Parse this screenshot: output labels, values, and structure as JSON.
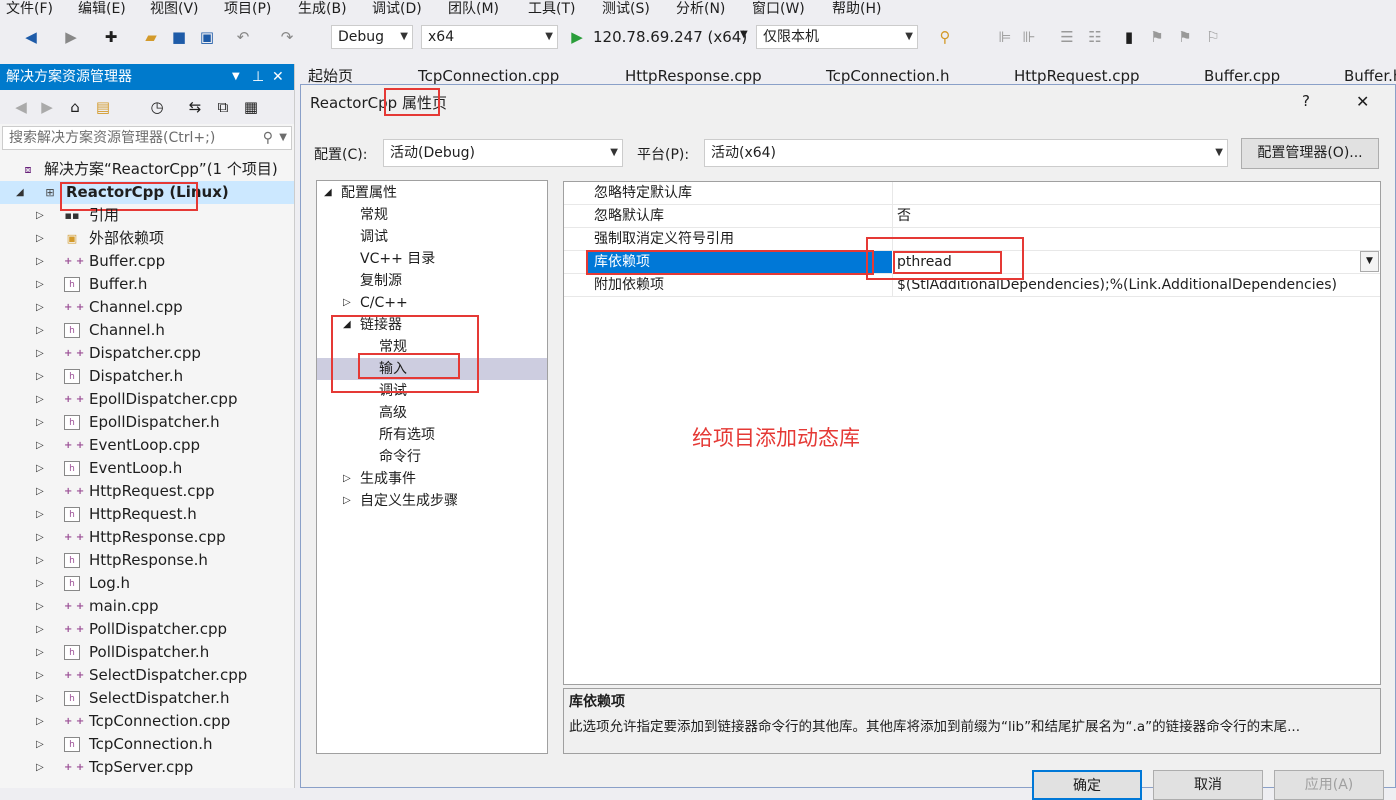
{
  "menu": [
    "文件(F)",
    "编辑(E)",
    "视图(V)",
    "项目(P)",
    "生成(B)",
    "调试(D)",
    "团队(M)",
    "工具(T)",
    "测试(S)",
    "分析(N)",
    "窗口(W)",
    "帮助(H)"
  ],
  "toolbar": {
    "config": "Debug",
    "platform": "x64",
    "run_target": "120.78.69.247 (x64)",
    "debug_scope": "仅限本机"
  },
  "solution_explorer": {
    "title": "解决方案资源管理器",
    "search_placeholder": "搜索解决方案资源管理器(Ctrl+;)",
    "solution": "解决方案“ReactorCpp”(1 个项目)",
    "project": "ReactorCpp (Linux)",
    "items": [
      {
        "label": "引用",
        "kind": "ref"
      },
      {
        "label": "外部依赖项",
        "kind": "ext"
      },
      {
        "label": "Buffer.cpp",
        "kind": "cpp"
      },
      {
        "label": "Buffer.h",
        "kind": "h"
      },
      {
        "label": "Channel.cpp",
        "kind": "cpp"
      },
      {
        "label": "Channel.h",
        "kind": "h"
      },
      {
        "label": "Dispatcher.cpp",
        "kind": "cpp"
      },
      {
        "label": "Dispatcher.h",
        "kind": "h"
      },
      {
        "label": "EpollDispatcher.cpp",
        "kind": "cpp"
      },
      {
        "label": "EpollDispatcher.h",
        "kind": "h"
      },
      {
        "label": "EventLoop.cpp",
        "kind": "cpp"
      },
      {
        "label": "EventLoop.h",
        "kind": "h"
      },
      {
        "label": "HttpRequest.cpp",
        "kind": "cpp"
      },
      {
        "label": "HttpRequest.h",
        "kind": "h"
      },
      {
        "label": "HttpResponse.cpp",
        "kind": "cpp"
      },
      {
        "label": "HttpResponse.h",
        "kind": "h"
      },
      {
        "label": "Log.h",
        "kind": "h"
      },
      {
        "label": "main.cpp",
        "kind": "cpp"
      },
      {
        "label": "PollDispatcher.cpp",
        "kind": "cpp"
      },
      {
        "label": "PollDispatcher.h",
        "kind": "h"
      },
      {
        "label": "SelectDispatcher.cpp",
        "kind": "cpp"
      },
      {
        "label": "SelectDispatcher.h",
        "kind": "h"
      },
      {
        "label": "TcpConnection.cpp",
        "kind": "cpp"
      },
      {
        "label": "TcpConnection.h",
        "kind": "h"
      },
      {
        "label": "TcpServer.cpp",
        "kind": "cpp"
      }
    ]
  },
  "tabs": [
    "起始页",
    "TcpConnection.cpp",
    "HttpResponse.cpp",
    "TcpConnection.h",
    "HttpRequest.cpp",
    "Buffer.cpp",
    "Buffer.h"
  ],
  "dialog": {
    "title_prefix": "ReactorCpp",
    "title_suffix": " 属性页",
    "help": "?",
    "close": "✕",
    "config_label": "配置(C):",
    "config_value": "活动(Debug)",
    "platform_label": "平台(P):",
    "platform_value": "活动(x64)",
    "config_manager": "配置管理器(O)...",
    "tree": {
      "root": "配置属性",
      "general": "常规",
      "debugging": "调试",
      "vcdirs": "VC++ 目录",
      "copy_source": "复制源",
      "cpp": "C/C++",
      "linker": "链接器",
      "linker_general": "常规",
      "linker_input": "输入",
      "linker_debug": "调试",
      "linker_advanced": "高级",
      "linker_all": "所有选项",
      "linker_cmdline": "命令行",
      "build_events": "生成事件",
      "custom_build": "自定义生成步骤"
    },
    "grid": [
      {
        "name": "忽略特定默认库",
        "value": ""
      },
      {
        "name": "忽略默认库",
        "value": "否"
      },
      {
        "name": "强制取消定义符号引用",
        "value": ""
      },
      {
        "name": "库依赖项",
        "value": "pthread"
      },
      {
        "name": "附加依赖项",
        "value": "$(StlAdditionalDependencies);%(Link.AdditionalDependencies)"
      }
    ],
    "annotation": "给项目添加动态库",
    "desc_title": "库依赖项",
    "desc_text": "此选项允许指定要添加到链接器命令行的其他库。其他库将添加到前缀为“lib”和结尾扩展名为“.a”的链接器命令行的末尾...",
    "ok": "确定",
    "cancel": "取消",
    "apply": "应用(A)"
  },
  "colors": {
    "accent": "#007acc",
    "highlight": "#e53935",
    "selection": "#0078d7"
  }
}
